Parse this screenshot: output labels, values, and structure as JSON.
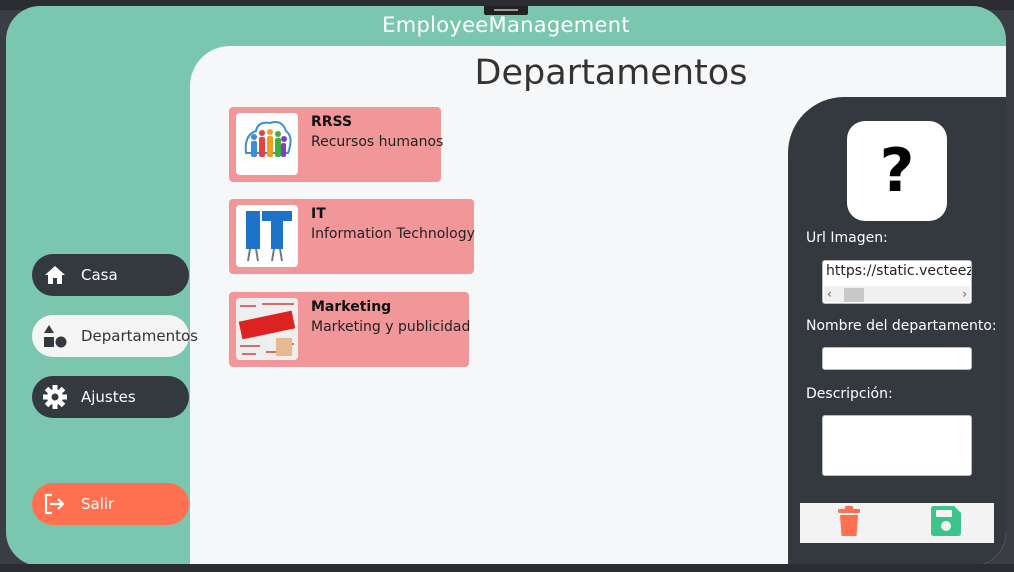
{
  "app": {
    "title": "EmployeeManagement"
  },
  "page": {
    "title": "Departamentos"
  },
  "nav": {
    "items": [
      {
        "label": "Casa",
        "icon": "home-icon"
      },
      {
        "label": "Departamentos",
        "icon": "shapes-icon",
        "active": true
      },
      {
        "label": "Ajustes",
        "icon": "gear-icon"
      }
    ],
    "logout": {
      "label": "Salir",
      "icon": "logout-icon"
    }
  },
  "departments": [
    {
      "name": "RRSS",
      "description": "Recursos humanos",
      "image": "people-logo"
    },
    {
      "name": "IT",
      "description": "Information Technology",
      "image": "it-letters"
    },
    {
      "name": "Marketing",
      "description": "Marketing y publicidad",
      "image": "marketing-collage"
    }
  ],
  "editor": {
    "image_icon": "question-mark-icon",
    "image_glyph": "?",
    "url_label": "Url Imagen:",
    "url_value": "https://static.vecteezy.",
    "name_label": "Nombre del departamento:",
    "name_value": "",
    "description_label": "Descripción:",
    "description_value": "",
    "delete_icon": "trash-icon",
    "save_icon": "save-icon"
  },
  "colors": {
    "accent": "#7ac6ae",
    "card": "#f1979a",
    "dark": "#34383f",
    "logout": "#ff7050",
    "delete": "#ff7050",
    "save": "#3cc48a"
  }
}
